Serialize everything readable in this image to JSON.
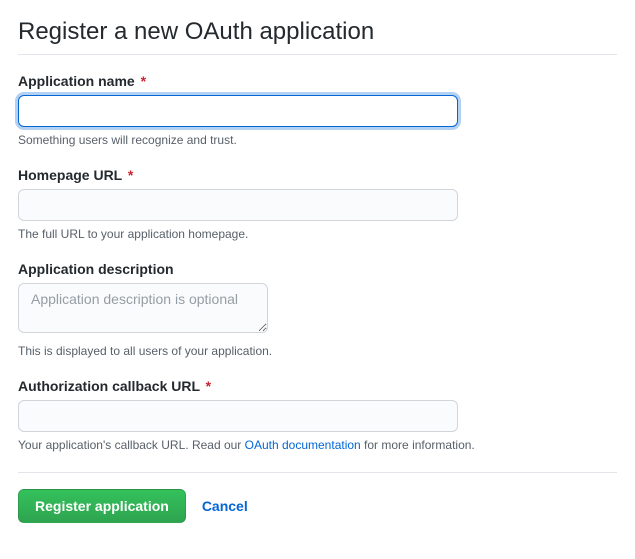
{
  "page_title": "Register a new OAuth application",
  "fields": {
    "app_name": {
      "label": "Application name",
      "value": "",
      "note": "Something users will recognize and trust.",
      "required": "*"
    },
    "homepage_url": {
      "label": "Homepage URL",
      "value": "",
      "note": "The full URL to your application homepage.",
      "required": "*"
    },
    "description": {
      "label": "Application description",
      "value": "",
      "placeholder": "Application description is optional",
      "note": "This is displayed to all users of your application."
    },
    "callback_url": {
      "label": "Authorization callback URL",
      "value": "",
      "note_before": "Your application's callback URL. Read our ",
      "note_link": "OAuth documentation",
      "note_after": " for more information.",
      "required": "*"
    }
  },
  "buttons": {
    "submit": "Register application",
    "cancel": "Cancel"
  }
}
